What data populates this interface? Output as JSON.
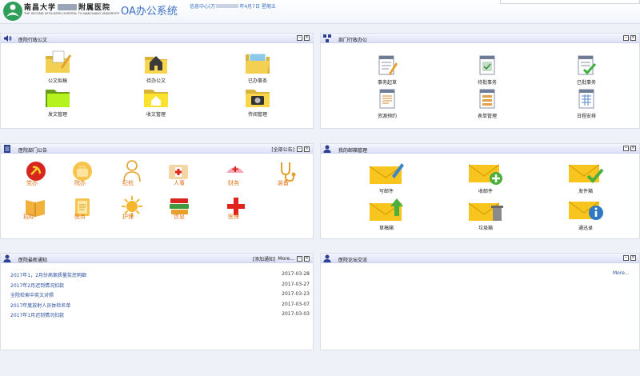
{
  "header": {
    "logo_cn_left": "南昌大学",
    "logo_cn_right": "附属医院",
    "logo_en": "THE SECOND AFFILIATED HOSPITAL TO NANCHANG UNIVERSITY",
    "app_title": "OA办公系统",
    "user_prefix": "信息中心(万",
    "user_suffix": "年4月7日 星期五"
  },
  "panels": {
    "official_docs": {
      "title": "医院行政公文",
      "tiles": [
        "公文拟稿",
        "待办公文",
        "已办事务",
        "发文管理",
        "收文管理",
        "传阅管理"
      ]
    },
    "dept_admin": {
      "title": "部门行政办公",
      "tiles": [
        "事务起草",
        "待批事务",
        "已批事务",
        "资源预约",
        "表单管理",
        "日程安排"
      ]
    },
    "dept_notice": {
      "title": "医院部门公告",
      "all_link": "[全部公告]",
      "items": [
        "党办",
        "院办",
        "纪检",
        "人事",
        "财务",
        "装备",
        "招标",
        "医务",
        "护理",
        "信息",
        "医保"
      ]
    },
    "mail": {
      "title": "我的邮箱管理",
      "tiles": [
        "写邮件",
        "收邮件",
        "发件箱",
        "草稿箱",
        "垃圾箱",
        "通迅录"
      ]
    },
    "latest_notice": {
      "title": "医院最新通知",
      "add_link": "[添加通知]",
      "more": "More...",
      "rows": [
        {
          "title": "2017年1，2月份病案质量奖惩明细",
          "date": "2017-03-28"
        },
        {
          "title": "2017年2月迟到情况扣款",
          "date": "2017-03-27"
        },
        {
          "title": "全院检索中英文对照",
          "date": "2017-03-23"
        },
        {
          "title": "2017年度放射人员体检名单",
          "date": "2017-03-07"
        },
        {
          "title": "2017年1月迟到情况扣款",
          "date": "2017-03-03"
        }
      ]
    },
    "forum": {
      "title": "医院论坛交流",
      "more": "More..."
    }
  },
  "controls": {
    "min": "−",
    "close": "×"
  },
  "colors": {
    "title_bar": "#dcdff7",
    "link": "#2a4f9e",
    "brand": "#3a6fc4",
    "dept_label": "#e2731a"
  }
}
